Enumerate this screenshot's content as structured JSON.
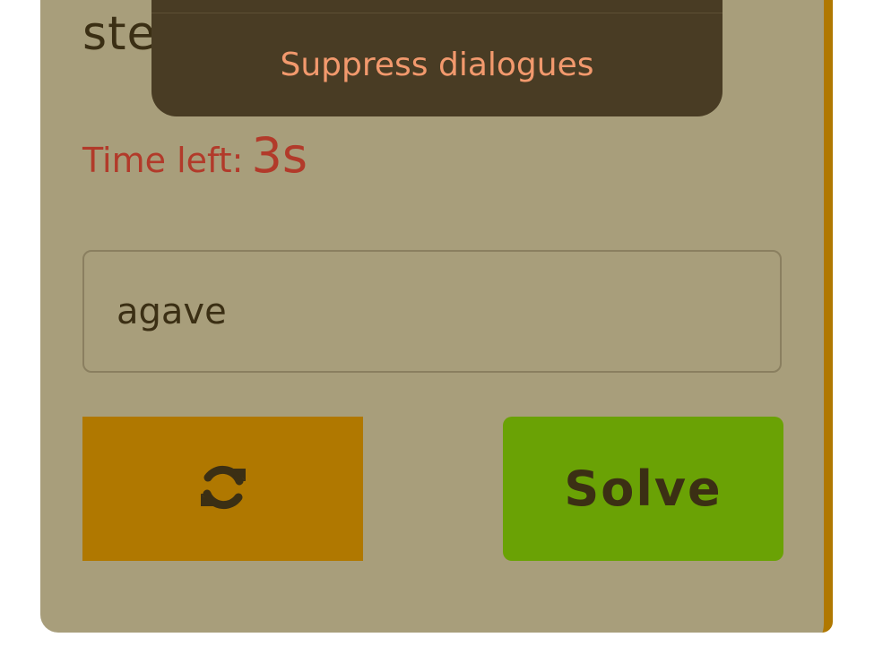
{
  "question": {
    "text": "ste"
  },
  "timer": {
    "label": "Time left:",
    "value": "3s"
  },
  "answer": {
    "value": "agave"
  },
  "buttons": {
    "refresh_icon": "refresh-icon",
    "solve_label": "Solve"
  },
  "overlay": {
    "suppress_label": "Suppress dialogues"
  },
  "colors": {
    "background": "#a89e7b",
    "accent": "#b07800",
    "solve": "#6aa205",
    "timer": "#b23a2a",
    "overlay": "#493c24",
    "overlay_text": "#f2996d"
  }
}
